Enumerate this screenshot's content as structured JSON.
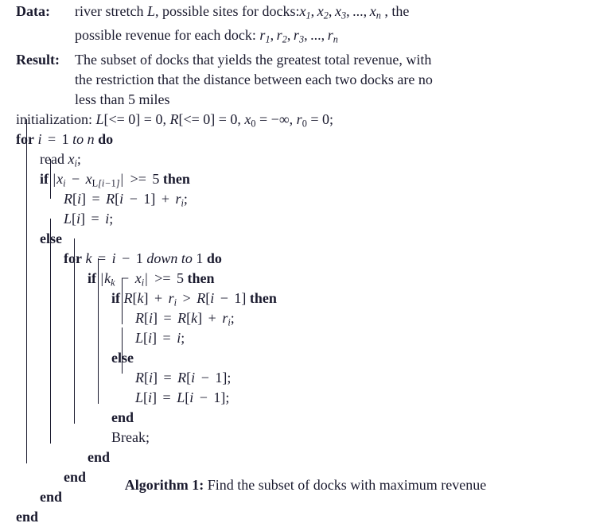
{
  "document": {
    "kind": "algorithm-pseudocode",
    "text_color": "#1a1a2e",
    "background_color": "#ffffff"
  },
  "header": {
    "data": {
      "label": "Data:",
      "lines": [
        "river stretch L, possible sites for docks:x₁, x₂, x₃, ..., xₙ , the",
        "possible revenue for each dock: r₁, r₂, r₃, ..., rₙ"
      ]
    },
    "result": {
      "label": "Result:",
      "lines": [
        "The subset of docks that yields the greatest total revenue, with",
        "the restriction that the distance between each two docks are no",
        "less than 5 miles"
      ]
    }
  },
  "body": {
    "lines": [
      {
        "id": "init",
        "indent": 0,
        "text": "initialization: L[<= 0] = 0, R[<= 0] = 0, x₀ = −∞, r₀ = 0;"
      },
      {
        "id": "for-i",
        "indent": 0,
        "text": "for i = 1 to n do"
      },
      {
        "id": "read-x",
        "indent": 1,
        "text": "read xᵢ;"
      },
      {
        "id": "if-dist",
        "indent": 1,
        "text": "if |xᵢ − x_L[i−1]| >= 5 then"
      },
      {
        "id": "r-assign-1",
        "indent": 2,
        "text": "R[i] = R[i − 1] + rᵢ;"
      },
      {
        "id": "l-assign-1",
        "indent": 2,
        "text": "L[i] = i;"
      },
      {
        "id": "else-outer",
        "indent": 1,
        "text": "else"
      },
      {
        "id": "for-k",
        "indent": 2,
        "text": "for k = i − 1 down to 1 do"
      },
      {
        "id": "if-kdist",
        "indent": 3,
        "text": "if |kₖ − xᵢ| >= 5 then"
      },
      {
        "id": "if-better",
        "indent": 4,
        "text": "if R[k] + rᵢ > R[i − 1] then"
      },
      {
        "id": "r-assign-2",
        "indent": 5,
        "text": "R[i] = R[k] + rᵢ;"
      },
      {
        "id": "l-assign-2",
        "indent": 5,
        "text": "L[i] = i;"
      },
      {
        "id": "else-inner",
        "indent": 4,
        "text": "else"
      },
      {
        "id": "r-assign-3",
        "indent": 5,
        "text": "R[i] = R[i − 1];"
      },
      {
        "id": "l-assign-3",
        "indent": 5,
        "text": "L[i] = L[i − 1];"
      },
      {
        "id": "end-if-best",
        "indent": 4,
        "text": "end"
      },
      {
        "id": "break",
        "indent": 4,
        "text": "Break;"
      },
      {
        "id": "end-if-kd",
        "indent": 3,
        "text": "end"
      },
      {
        "id": "end-for-k",
        "indent": 2,
        "text": "end"
      },
      {
        "id": "end-else",
        "indent": 1,
        "text": "end"
      },
      {
        "id": "end-for-i",
        "indent": 0,
        "text": "end"
      }
    ],
    "keywords": [
      "for",
      "to",
      "do",
      "if",
      "then",
      "else",
      "end",
      "down",
      "read",
      "Break",
      "initialization"
    ]
  },
  "caption": {
    "number_label": "Algorithm 1:",
    "text": "Find the subset of docks with maximum revenue"
  }
}
